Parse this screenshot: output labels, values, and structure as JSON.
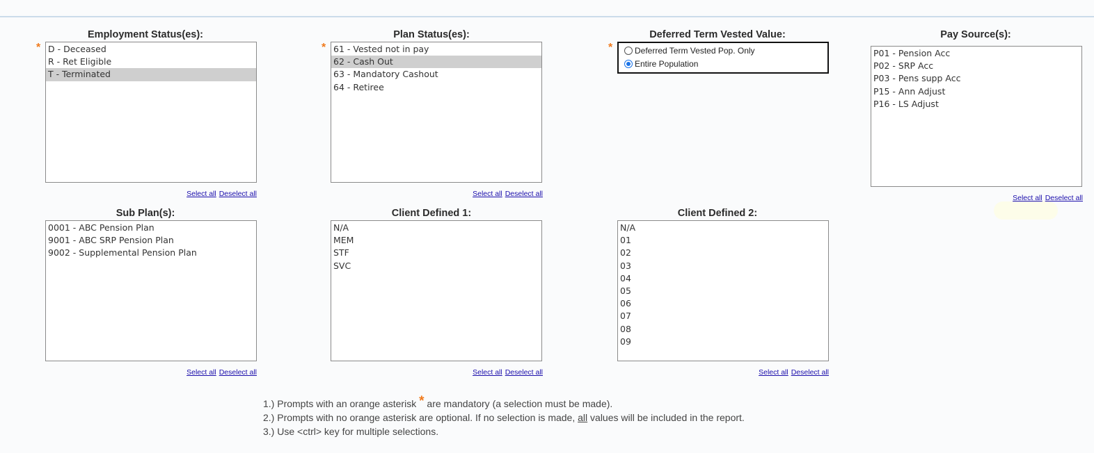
{
  "employment": {
    "title": "Employment Status(es):",
    "options": [
      "D - Deceased",
      "R - Ret Eligible",
      "T - Terminated"
    ],
    "selected": [
      2
    ],
    "select_all": "Select all",
    "deselect_all": "Deselect all"
  },
  "plan_status": {
    "title": "Plan Status(es):",
    "options": [
      "61 - Vested not in pay",
      "62 - Cash Out",
      "63 - Mandatory Cashout",
      "64 - Retiree"
    ],
    "selected": [
      1
    ],
    "select_all": "Select all",
    "deselect_all": "Deselect all"
  },
  "deferred": {
    "title": "Deferred Term Vested Value:",
    "option1": "Deferred Term Vested Pop. Only",
    "option2": "Entire Population",
    "selected": 2
  },
  "pay_source": {
    "title": "Pay Source(s):",
    "options": [
      "P01 - Pension Acc",
      "P02 - SRP Acc",
      "P03 - Pens supp Acc",
      "P15 - Ann Adjust",
      "P16 - LS Adjust"
    ],
    "selected": [],
    "select_all": "Select all",
    "deselect_all": "Deselect all"
  },
  "sub_plan": {
    "title": "Sub Plan(s):",
    "options": [
      "0001 - ABC Pension Plan",
      "9001 - ABC SRP Pension Plan",
      "9002 - Supplemental Pension Plan"
    ],
    "selected": [],
    "select_all": "Select all",
    "deselect_all": "Deselect all"
  },
  "client1": {
    "title": "Client Defined 1:",
    "options": [
      "N/A",
      "MEM",
      "STF",
      "SVC"
    ],
    "selected": [],
    "select_all": "Select all",
    "deselect_all": "Deselect all"
  },
  "client2": {
    "title": "Client Defined 2:",
    "options": [
      "N/A",
      "01",
      "02",
      "03",
      "04",
      "05",
      "06",
      "07",
      "08",
      "09"
    ],
    "selected": [],
    "select_all": "Select all",
    "deselect_all": "Deselect all"
  },
  "notes": {
    "n1_pre": "1.) Prompts with an orange asterisk ",
    "asterisk": "*",
    "n1_post": " are mandatory (a selection must be made).",
    "n2_pre": "2.) Prompts with no orange asterisk are optional.  If no selection is made, ",
    "n2_all": "all",
    "n2_post": " values will be included in the report.",
    "n3": "3.) Use <ctrl> key for multiple selections."
  },
  "colors": {
    "asterisk": "#f07a1c",
    "selected_bg": "#cfcfcf",
    "link": "#1a0dab",
    "radio_checked": "#1a73e8"
  }
}
